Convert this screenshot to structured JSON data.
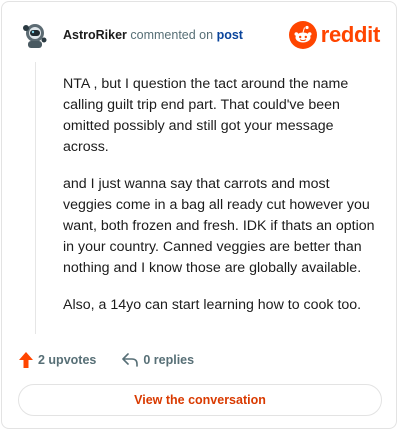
{
  "header": {
    "author": "AstroRiker",
    "commented_on": "commented on",
    "post_link": "post",
    "logo_text": "reddit",
    "logo_icon": "reddit-snoo-icon",
    "brand_color": "#ff4500"
  },
  "comment": {
    "paragraphs": [
      "NTA , but I question the tact around the name calling guilt trip end part. That could've been omitted possibly and still got your message across.",
      "and I just wanna say that carrots and most veggies come in a bag all ready cut however you want, both frozen and fresh. IDK if thats an option in your country. Canned veggies are better than nothing and I know those are globally available.",
      "Also, a 14yo can start learning how to cook too."
    ]
  },
  "actions": {
    "upvotes": "2 upvotes",
    "upvote_icon": "upvote-arrow-icon",
    "replies": "0 replies",
    "reply_icon": "reply-arrow-icon"
  },
  "view_button": {
    "label": "View the conversation",
    "color": "#d93a00"
  }
}
